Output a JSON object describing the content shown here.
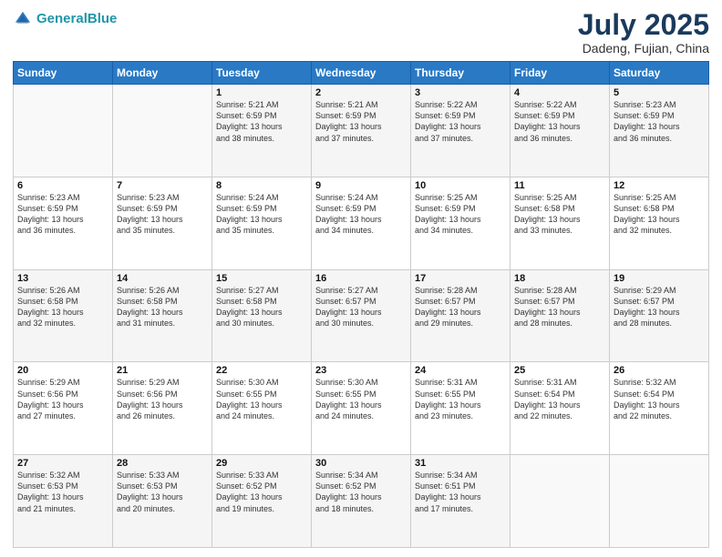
{
  "header": {
    "logo_line1": "General",
    "logo_line2": "Blue",
    "month_year": "July 2025",
    "location": "Dadeng, Fujian, China"
  },
  "days_of_week": [
    "Sunday",
    "Monday",
    "Tuesday",
    "Wednesday",
    "Thursday",
    "Friday",
    "Saturday"
  ],
  "weeks": [
    [
      {
        "day": "",
        "info": ""
      },
      {
        "day": "",
        "info": ""
      },
      {
        "day": "1",
        "info": "Sunrise: 5:21 AM\nSunset: 6:59 PM\nDaylight: 13 hours\nand 38 minutes."
      },
      {
        "day": "2",
        "info": "Sunrise: 5:21 AM\nSunset: 6:59 PM\nDaylight: 13 hours\nand 37 minutes."
      },
      {
        "day": "3",
        "info": "Sunrise: 5:22 AM\nSunset: 6:59 PM\nDaylight: 13 hours\nand 37 minutes."
      },
      {
        "day": "4",
        "info": "Sunrise: 5:22 AM\nSunset: 6:59 PM\nDaylight: 13 hours\nand 36 minutes."
      },
      {
        "day": "5",
        "info": "Sunrise: 5:23 AM\nSunset: 6:59 PM\nDaylight: 13 hours\nand 36 minutes."
      }
    ],
    [
      {
        "day": "6",
        "info": "Sunrise: 5:23 AM\nSunset: 6:59 PM\nDaylight: 13 hours\nand 36 minutes."
      },
      {
        "day": "7",
        "info": "Sunrise: 5:23 AM\nSunset: 6:59 PM\nDaylight: 13 hours\nand 35 minutes."
      },
      {
        "day": "8",
        "info": "Sunrise: 5:24 AM\nSunset: 6:59 PM\nDaylight: 13 hours\nand 35 minutes."
      },
      {
        "day": "9",
        "info": "Sunrise: 5:24 AM\nSunset: 6:59 PM\nDaylight: 13 hours\nand 34 minutes."
      },
      {
        "day": "10",
        "info": "Sunrise: 5:25 AM\nSunset: 6:59 PM\nDaylight: 13 hours\nand 34 minutes."
      },
      {
        "day": "11",
        "info": "Sunrise: 5:25 AM\nSunset: 6:58 PM\nDaylight: 13 hours\nand 33 minutes."
      },
      {
        "day": "12",
        "info": "Sunrise: 5:25 AM\nSunset: 6:58 PM\nDaylight: 13 hours\nand 32 minutes."
      }
    ],
    [
      {
        "day": "13",
        "info": "Sunrise: 5:26 AM\nSunset: 6:58 PM\nDaylight: 13 hours\nand 32 minutes."
      },
      {
        "day": "14",
        "info": "Sunrise: 5:26 AM\nSunset: 6:58 PM\nDaylight: 13 hours\nand 31 minutes."
      },
      {
        "day": "15",
        "info": "Sunrise: 5:27 AM\nSunset: 6:58 PM\nDaylight: 13 hours\nand 30 minutes."
      },
      {
        "day": "16",
        "info": "Sunrise: 5:27 AM\nSunset: 6:57 PM\nDaylight: 13 hours\nand 30 minutes."
      },
      {
        "day": "17",
        "info": "Sunrise: 5:28 AM\nSunset: 6:57 PM\nDaylight: 13 hours\nand 29 minutes."
      },
      {
        "day": "18",
        "info": "Sunrise: 5:28 AM\nSunset: 6:57 PM\nDaylight: 13 hours\nand 28 minutes."
      },
      {
        "day": "19",
        "info": "Sunrise: 5:29 AM\nSunset: 6:57 PM\nDaylight: 13 hours\nand 28 minutes."
      }
    ],
    [
      {
        "day": "20",
        "info": "Sunrise: 5:29 AM\nSunset: 6:56 PM\nDaylight: 13 hours\nand 27 minutes."
      },
      {
        "day": "21",
        "info": "Sunrise: 5:29 AM\nSunset: 6:56 PM\nDaylight: 13 hours\nand 26 minutes."
      },
      {
        "day": "22",
        "info": "Sunrise: 5:30 AM\nSunset: 6:55 PM\nDaylight: 13 hours\nand 24 minutes."
      },
      {
        "day": "23",
        "info": "Sunrise: 5:30 AM\nSunset: 6:55 PM\nDaylight: 13 hours\nand 24 minutes."
      },
      {
        "day": "24",
        "info": "Sunrise: 5:31 AM\nSunset: 6:55 PM\nDaylight: 13 hours\nand 23 minutes."
      },
      {
        "day": "25",
        "info": "Sunrise: 5:31 AM\nSunset: 6:54 PM\nDaylight: 13 hours\nand 22 minutes."
      },
      {
        "day": "26",
        "info": "Sunrise: 5:32 AM\nSunset: 6:54 PM\nDaylight: 13 hours\nand 22 minutes."
      }
    ],
    [
      {
        "day": "27",
        "info": "Sunrise: 5:32 AM\nSunset: 6:53 PM\nDaylight: 13 hours\nand 21 minutes."
      },
      {
        "day": "28",
        "info": "Sunrise: 5:33 AM\nSunset: 6:53 PM\nDaylight: 13 hours\nand 20 minutes."
      },
      {
        "day": "29",
        "info": "Sunrise: 5:33 AM\nSunset: 6:52 PM\nDaylight: 13 hours\nand 19 minutes."
      },
      {
        "day": "30",
        "info": "Sunrise: 5:34 AM\nSunset: 6:52 PM\nDaylight: 13 hours\nand 18 minutes."
      },
      {
        "day": "31",
        "info": "Sunrise: 5:34 AM\nSunset: 6:51 PM\nDaylight: 13 hours\nand 17 minutes."
      },
      {
        "day": "",
        "info": ""
      },
      {
        "day": "",
        "info": ""
      }
    ]
  ]
}
